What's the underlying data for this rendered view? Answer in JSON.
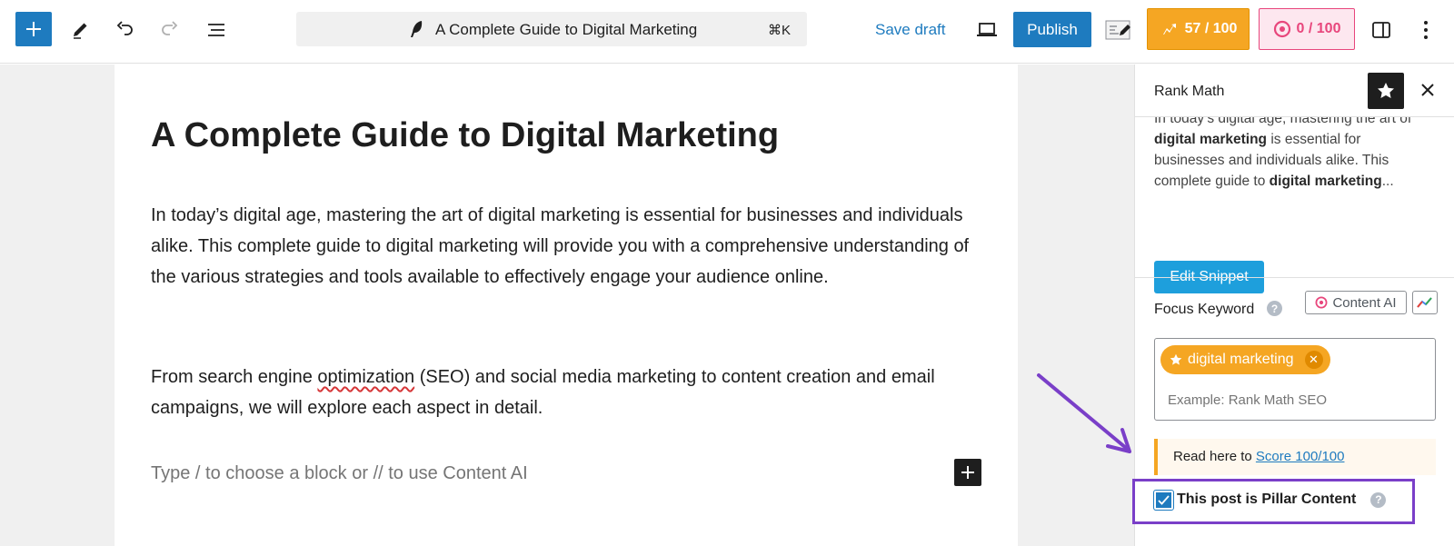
{
  "toolbar": {
    "document_title": "A Complete Guide to Digital Marketing",
    "command_shortcut": "⌘K",
    "save_draft_label": "Save draft",
    "publish_label": "Publish",
    "seo_score": "57 / 100",
    "content_ai_score": "0 / 100"
  },
  "editor": {
    "post_title": "A Complete Guide to Digital Marketing",
    "paragraph_1": "In today’s digital age, mastering the art of digital marketing is essential for businesses and individuals alike. This complete guide to digital marketing will provide you with a comprehensive understanding of the various strategies and tools available to effectively engage your audience online.",
    "paragraph_2_before": "From search engine ",
    "paragraph_2_misspelled": "optimization",
    "paragraph_2_after": " (SEO) and social media marketing to content creation and email campaigns, we will explore each aspect in detail.",
    "block_placeholder": "Type / to choose a block or // to use Content AI"
  },
  "sidebar": {
    "title": "Rank Math",
    "snippet_partial_top": "In today’s digital age, mastering the art of",
    "snippet_bold_1": "digital marketing",
    "snippet_mid": " is essential for businesses and individuals alike. This complete guide to ",
    "snippet_bold_2": "digital marketing",
    "snippet_end": "...",
    "edit_snippet_label": "Edit Snippet",
    "focus_keyword_label": "Focus Keyword",
    "content_ai_button": "Content AI",
    "keyword_tag": "digital marketing",
    "keyword_placeholder": "Example: Rank Math SEO",
    "notice_text": "Read here to ",
    "notice_link": "Score 100/100",
    "pillar_label": "This post is Pillar Content",
    "pillar_checked": true
  },
  "colors": {
    "wp_blue": "#1e7bbf",
    "rank_math_orange": "#f5a623",
    "content_ai_pink": "#e8467c",
    "annotation_purple": "#7a3fc8"
  }
}
